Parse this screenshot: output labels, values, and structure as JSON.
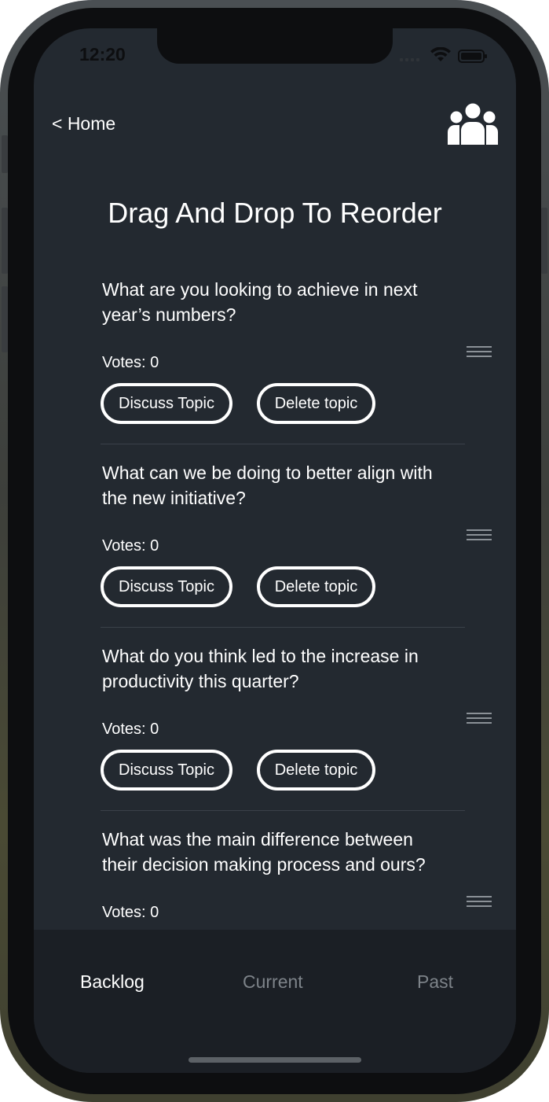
{
  "status_bar": {
    "time": "12:20"
  },
  "nav": {
    "back_label": "< Home",
    "team_icon": "team-icon"
  },
  "page": {
    "title": "Drag And Drop To Reorder"
  },
  "topics": [
    {
      "question": "What are you looking to achieve in next year’s numbers?",
      "votes": "Votes: 0",
      "discuss_label": "Discuss Topic",
      "delete_label": "Delete topic"
    },
    {
      "question": "What can we be doing to better align with the new initiative?",
      "votes": "Votes: 0",
      "discuss_label": "Discuss Topic",
      "delete_label": "Delete topic"
    },
    {
      "question": "What do you think led to the increase in productivity this quarter?",
      "votes": "Votes: 0",
      "discuss_label": "Discuss Topic",
      "delete_label": "Delete topic"
    },
    {
      "question": "What was the main difference between their decision making process and ours?",
      "votes": "Votes: 0"
    }
  ],
  "tabs": [
    {
      "label": "Backlog",
      "active": true
    },
    {
      "label": "Current",
      "active": false
    },
    {
      "label": "Past",
      "active": false
    }
  ],
  "colors": {
    "background": "#232930",
    "tabbar": "#1b1f25",
    "text": "#ffffff",
    "inactive_tab": "#7d8389"
  }
}
